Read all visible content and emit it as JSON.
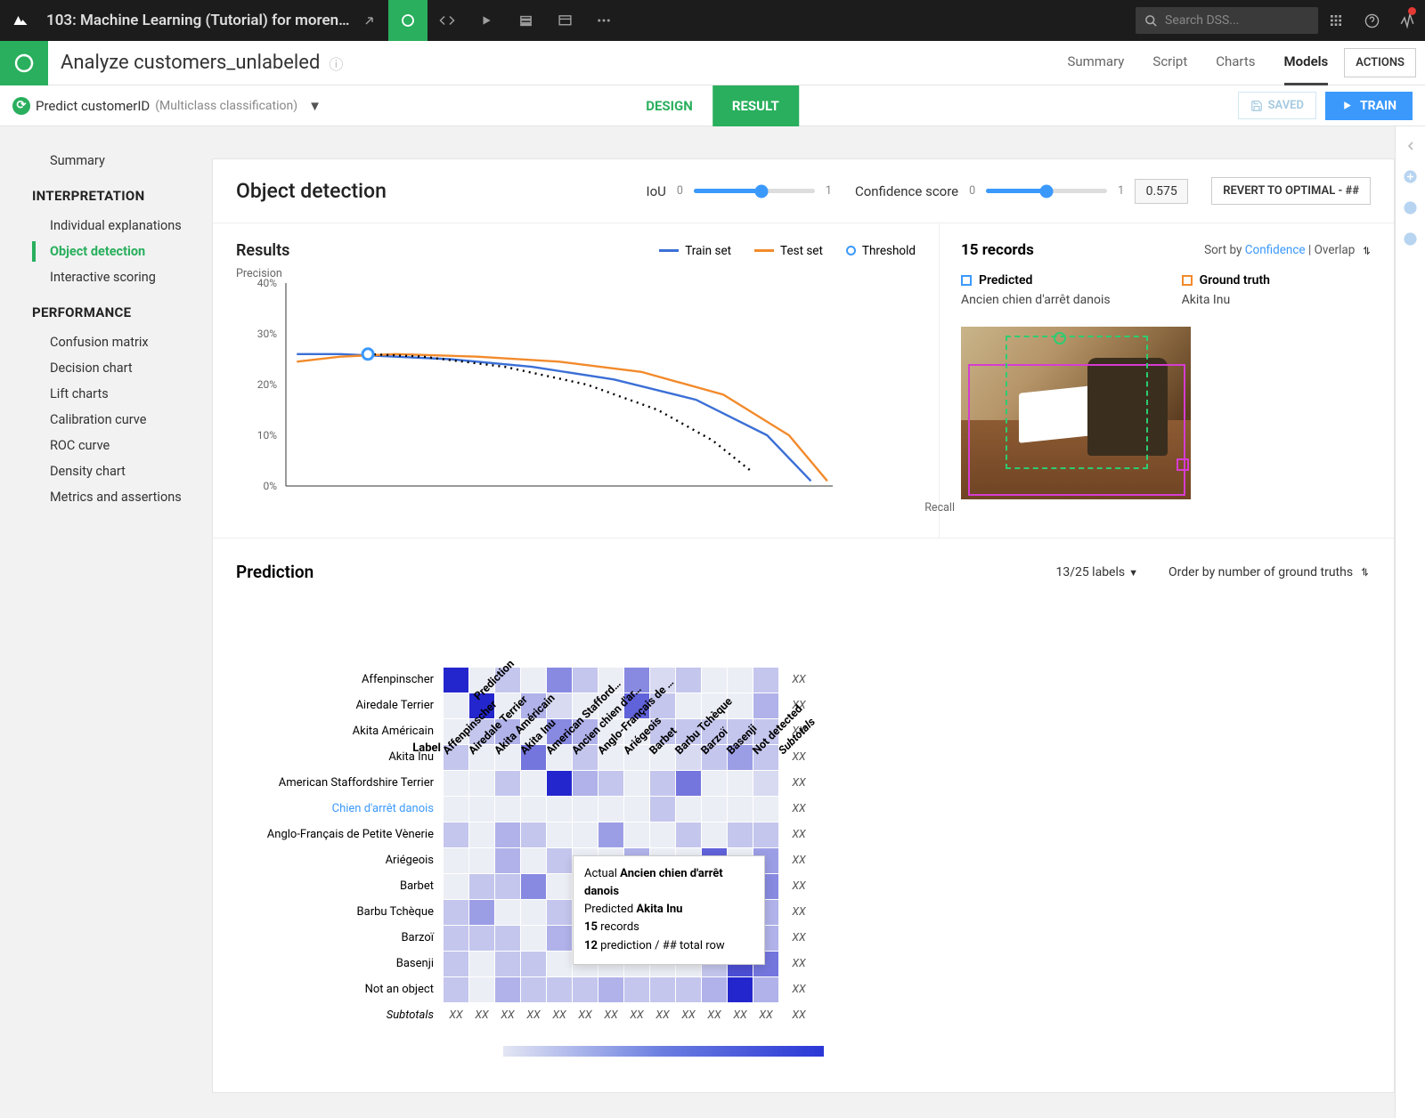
{
  "topbar": {
    "project": "103: Machine Learning (Tutorial) for moren…",
    "search_placeholder": "Search DSS..."
  },
  "subheader": {
    "title": "Analyze customers_unlabeled",
    "tabs": [
      "Summary",
      "Script",
      "Charts",
      "Models"
    ],
    "active_tab": "Models",
    "actions": "ACTIONS"
  },
  "drbar": {
    "predict_label": "Predict customerID",
    "predict_sub": "(Multiclass classification)",
    "design": "DESIGN",
    "result": "RESULT",
    "saved": "SAVED",
    "train": "TRAIN"
  },
  "sidenav": {
    "summary": "Summary",
    "interpretation_head": "INTERPRETATION",
    "interpretation": [
      "Individual explanations",
      "Object detection",
      "Interactive scoring"
    ],
    "performance_head": "PERFORMANCE",
    "performance": [
      "Confusion matrix",
      "Decision chart",
      "Lift charts",
      "Calibration curve",
      "ROC curve",
      "Density chart",
      "Metrics and assertions"
    ],
    "active": "Object detection"
  },
  "panel": {
    "title": "Object detection",
    "iou_label": "IoU",
    "conf_label": "Confidence score",
    "min": "0",
    "max": "1",
    "conf_value": "0.575",
    "revert": "REVERT TO OPTIMAL - ##"
  },
  "results": {
    "title": "Results",
    "legend_train": "Train set",
    "legend_test": "Test set",
    "legend_threshold": "Threshold",
    "ylabel": "Precision",
    "xlabel": "Recall"
  },
  "chart_data": {
    "type": "line",
    "xlabel": "Recall",
    "ylabel": "Precision",
    "ylim": [
      0,
      0.4
    ],
    "yticks": [
      "0%",
      "10%",
      "20%",
      "30%",
      "40%"
    ],
    "series": [
      {
        "name": "Train set",
        "color": "#3b6fd6",
        "points": [
          [
            0.02,
            0.26
          ],
          [
            0.1,
            0.26
          ],
          [
            0.2,
            0.255
          ],
          [
            0.3,
            0.25
          ],
          [
            0.45,
            0.235
          ],
          [
            0.6,
            0.21
          ],
          [
            0.75,
            0.17
          ],
          [
            0.88,
            0.1
          ],
          [
            0.96,
            0.01
          ]
        ]
      },
      {
        "name": "Test set",
        "color": "#f28a2b",
        "points": [
          [
            0.02,
            0.245
          ],
          [
            0.1,
            0.255
          ],
          [
            0.2,
            0.26
          ],
          [
            0.35,
            0.255
          ],
          [
            0.5,
            0.245
          ],
          [
            0.65,
            0.225
          ],
          [
            0.8,
            0.18
          ],
          [
            0.92,
            0.1
          ],
          [
            0.99,
            0.01
          ]
        ]
      },
      {
        "name": "Threshold",
        "color": "#000",
        "dashed": true,
        "points": [
          [
            0.15,
            0.26
          ],
          [
            0.25,
            0.255
          ],
          [
            0.4,
            0.235
          ],
          [
            0.55,
            0.2
          ],
          [
            0.68,
            0.15
          ],
          [
            0.78,
            0.09
          ],
          [
            0.85,
            0.03
          ]
        ]
      }
    ],
    "marker": {
      "x": 0.15,
      "y": 0.26
    }
  },
  "records": {
    "title": "15 records",
    "sort_prefix": "Sort by ",
    "sort_link": "Confidence",
    "sort_suffix": " | Overlap",
    "predicted_label": "Predicted",
    "predicted_value": "Ancien chien d'arrêt danois",
    "truth_label": "Ground truth",
    "truth_value": "Akita Inu"
  },
  "prediction": {
    "title": "Prediction",
    "labels_filter": "13/25 labels",
    "order": "Order by number of ground truths",
    "col_header": "Prediction",
    "row_header": "Label",
    "columns": [
      "Affenpinscher",
      "Airedale Terrier",
      "Akita Américain",
      "Akita Inu",
      "American Stafford…",
      "Ancien chien d'ar…",
      "Anglo-Français de …",
      "Ariégeois",
      "Barbet",
      "Barbu Tchèque",
      "Barzoï",
      "Basenji",
      "Not detected"
    ],
    "subtotals_label": "Subtotals",
    "subtotal_value": "XX",
    "rows": [
      {
        "label": "Affenpinscher",
        "cells": [
          10,
          0,
          2,
          0,
          5,
          2,
          0,
          5,
          1,
          2,
          0,
          0,
          2
        ]
      },
      {
        "label": "Airedale Terrier",
        "cells": [
          0,
          10,
          0,
          3,
          1,
          0,
          0,
          7,
          2,
          0,
          0,
          0,
          3
        ]
      },
      {
        "label": "Akita Américain",
        "cells": [
          0,
          2,
          3,
          0,
          5,
          3,
          0,
          0,
          2,
          2,
          2,
          2,
          2
        ]
      },
      {
        "label": "Akita Inu",
        "cells": [
          2,
          0,
          0,
          6,
          0,
          2,
          0,
          0,
          0,
          1,
          2,
          4,
          2
        ]
      },
      {
        "label": "American Staffordshire Terrier",
        "cells": [
          0,
          0,
          2,
          0,
          10,
          3,
          2,
          0,
          2,
          6,
          0,
          0,
          1
        ]
      },
      {
        "label": "Chien d'arrêt danois",
        "hl": true,
        "cells": [
          0,
          0,
          0,
          0,
          0,
          0,
          0,
          0,
          2,
          0,
          0,
          0,
          0
        ]
      },
      {
        "label": "Anglo-Français de Petite Vènerie",
        "cells": [
          2,
          0,
          3,
          2,
          0,
          0,
          4,
          0,
          0,
          2,
          0,
          2,
          2
        ]
      },
      {
        "label": "Ariégeois",
        "cells": [
          0,
          0,
          3,
          0,
          2,
          0,
          0,
          3,
          0,
          0,
          7,
          0,
          4
        ]
      },
      {
        "label": "Barbet",
        "cells": [
          0,
          2,
          2,
          5,
          0,
          0,
          0,
          3,
          4,
          0,
          3,
          0,
          5
        ]
      },
      {
        "label": "Barbu Tchèque",
        "cells": [
          2,
          4,
          0,
          0,
          2,
          0,
          0,
          0,
          0,
          3,
          8,
          8,
          3
        ]
      },
      {
        "label": "Barzoï",
        "cells": [
          2,
          2,
          2,
          0,
          3,
          0,
          4,
          0,
          2,
          2,
          4,
          0,
          3
        ]
      },
      {
        "label": "Basenji",
        "cells": [
          2,
          0,
          2,
          2,
          0,
          0,
          0,
          0,
          0,
          0,
          2,
          8,
          6
        ]
      },
      {
        "label": "Not an object",
        "cells": [
          2,
          0,
          3,
          2,
          2,
          2,
          3,
          2,
          2,
          2,
          3,
          10,
          3
        ]
      }
    ]
  },
  "tooltip": {
    "l1a": "Actual ",
    "l1b": "Ancien chien d'arrêt danois",
    "l2a": "Predicted ",
    "l2b": "Akita Inu",
    "l3a": "15",
    "l3b": " records",
    "l4a": "12",
    "l4b": " prediction / ## total row"
  }
}
